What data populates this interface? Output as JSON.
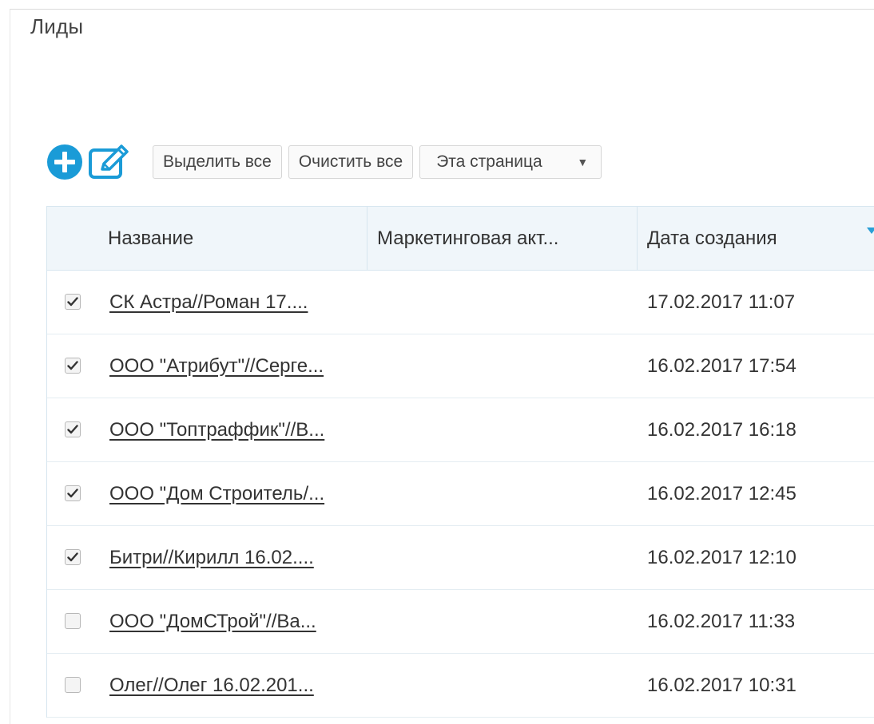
{
  "page": {
    "title": "Лиды"
  },
  "toolbar": {
    "add_icon": "plus-circle-icon",
    "edit_icon": "edit-icon",
    "select_all_label": "Выделить все",
    "clear_all_label": "Очистить все",
    "scope_select_value": "Эта страница",
    "accent_color": "#1a9bd7"
  },
  "table": {
    "columns": [
      {
        "label": "Название"
      },
      {
        "label": "Маркетинговая акт..."
      },
      {
        "label": "Дата создания"
      }
    ],
    "rows": [
      {
        "checked": true,
        "name": "СК Астра//Роман 17....",
        "campaign": "",
        "created": "17.02.2017 11:07"
      },
      {
        "checked": true,
        "name": "ООО \"Атрибут\"//Серге...",
        "campaign": "",
        "created": "16.02.2017 17:54"
      },
      {
        "checked": true,
        "name": "ООО \"Топтраффик\"//В...",
        "campaign": "",
        "created": "16.02.2017 16:18"
      },
      {
        "checked": true,
        "name": "ООО \"Дом Строитель/...",
        "campaign": "",
        "created": "16.02.2017 12:45"
      },
      {
        "checked": true,
        "name": "Битри//Кирилл 16.02....",
        "campaign": "",
        "created": "16.02.2017 12:10"
      },
      {
        "checked": false,
        "name": "ООО \"ДомСТрой\"//Ва...",
        "campaign": "",
        "created": "16.02.2017 11:33"
      },
      {
        "checked": false,
        "name": "Олег//Олег 16.02.201...",
        "campaign": "",
        "created": "16.02.2017 10:31"
      }
    ]
  }
}
